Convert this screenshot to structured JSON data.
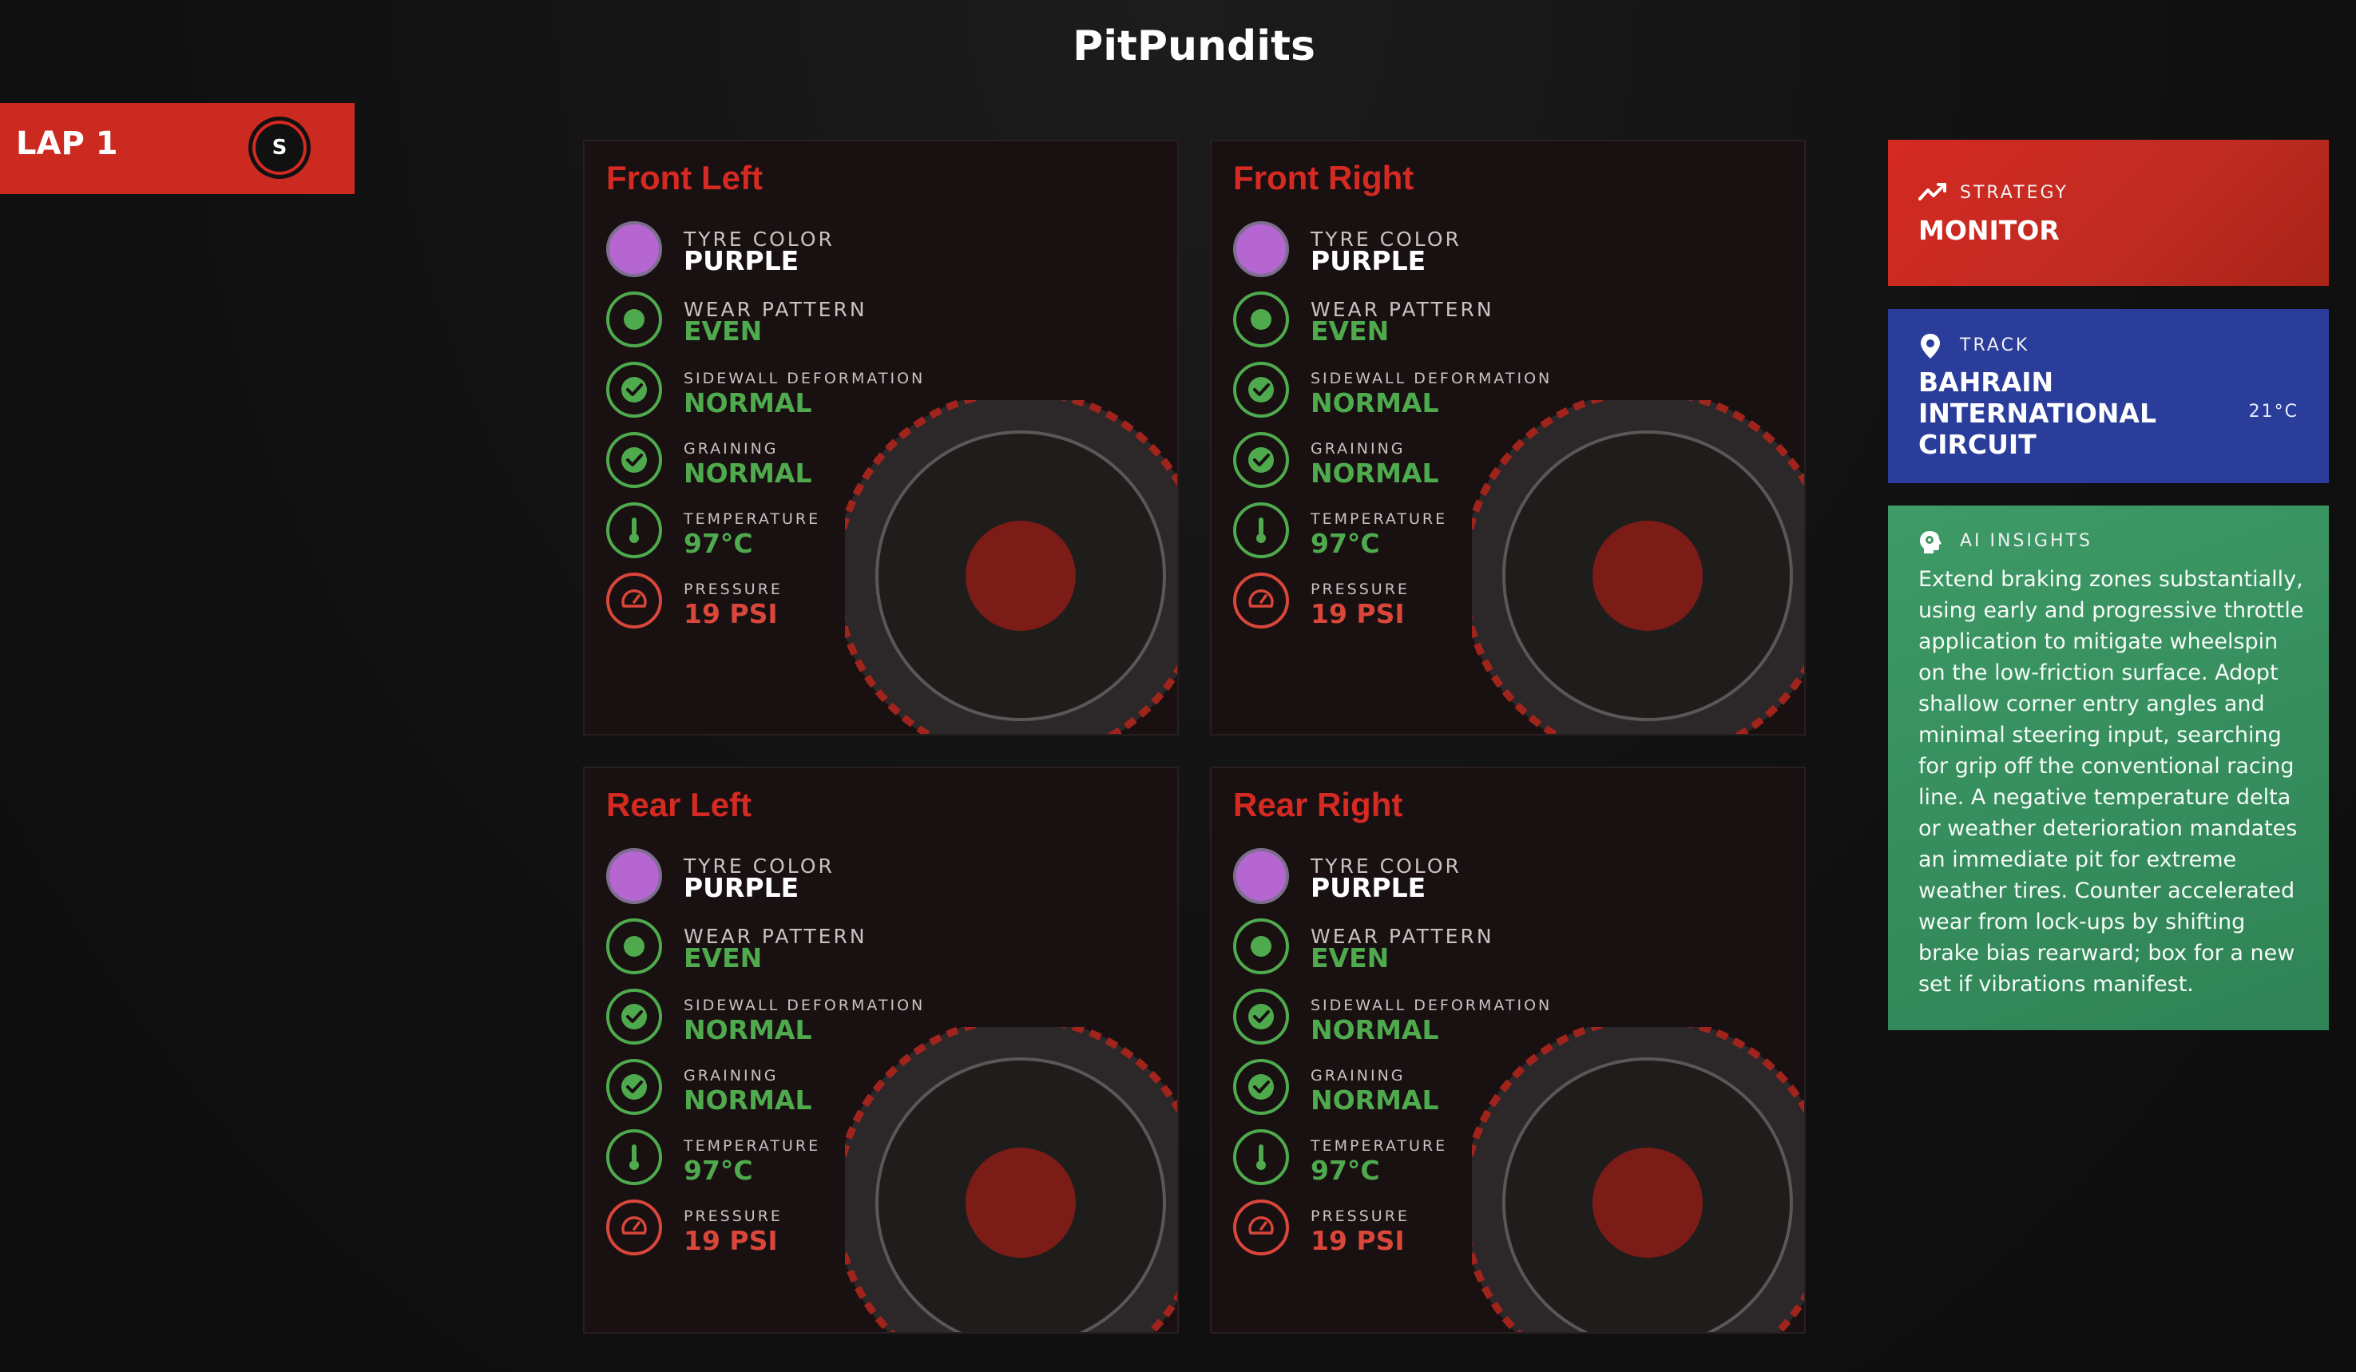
{
  "app": {
    "title": "PitPundits"
  },
  "lap": {
    "label": "LAP 1",
    "compound_letter": "S"
  },
  "labels": {
    "tyre_color": "TYRE COLOR",
    "wear_pattern": "WEAR PATTERN",
    "sidewall": "SIDEWALL DEFORMATION",
    "graining": "GRAINING",
    "temperature": "TEMPERATURE",
    "pressure": "PRESSURE"
  },
  "tyres": [
    {
      "position": "Front Left",
      "tyre_color": "PURPLE",
      "wear_pattern": "EVEN",
      "sidewall": "NORMAL",
      "graining": "NORMAL",
      "temperature": "97°C",
      "pressure": "19 PSI"
    },
    {
      "position": "Front Right",
      "tyre_color": "PURPLE",
      "wear_pattern": "EVEN",
      "sidewall": "NORMAL",
      "graining": "NORMAL",
      "temperature": "97°C",
      "pressure": "19 PSI"
    },
    {
      "position": "Rear Left",
      "tyre_color": "PURPLE",
      "wear_pattern": "EVEN",
      "sidewall": "NORMAL",
      "graining": "NORMAL",
      "temperature": "97°C",
      "pressure": "19 PSI"
    },
    {
      "position": "Rear Right",
      "tyre_color": "PURPLE",
      "wear_pattern": "EVEN",
      "sidewall": "NORMAL",
      "graining": "NORMAL",
      "temperature": "97°C",
      "pressure": "19 PSI"
    }
  ],
  "strategy": {
    "heading": "STRATEGY",
    "value": "MONITOR",
    "icon": "trend-line-icon"
  },
  "track": {
    "heading": "TRACK",
    "name": "BAHRAIN INTERNATIONAL CIRCUIT",
    "temperature": "21°C",
    "icon": "map-pin-icon"
  },
  "ai_insights": {
    "heading": "AI INSIGHTS",
    "icon": "brain-head-icon",
    "text": "Extend braking zones substantially, using early and progressive throttle application to mitigate wheelspin on the low-friction surface. Adopt shallow corner entry angles and minimal steering input, searching for grip off the conventional racing line. A negative temperature delta or weather deterioration mandates an immediate pit for extreme weather tires. Counter accelerated wear from lock-ups by shifting brake bias rearward; box for a new set if vibrations manifest."
  },
  "colors": {
    "accent_red": "#d42a22",
    "ok_green": "#4faa4d",
    "alert_red": "#d9463a",
    "tyre_purple": "#b566d0",
    "track_blue": "#2a3d9a",
    "ai_green": "#3e9a66"
  }
}
